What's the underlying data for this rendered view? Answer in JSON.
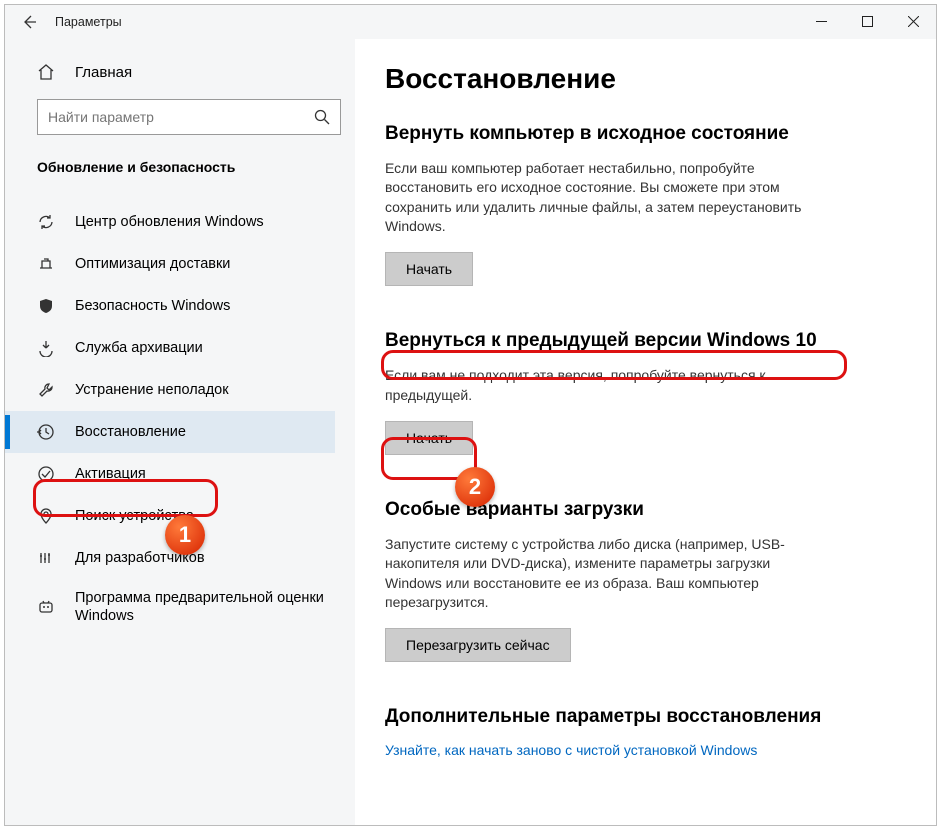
{
  "titlebar": {
    "title": "Параметры"
  },
  "sidebar": {
    "home": "Главная",
    "search_placeholder": "Найти параметр",
    "category": "Обновление и безопасность",
    "items": [
      {
        "label": "Центр обновления Windows"
      },
      {
        "label": "Оптимизация доставки"
      },
      {
        "label": "Безопасность Windows"
      },
      {
        "label": "Служба архивации"
      },
      {
        "label": "Устранение неполадок"
      },
      {
        "label": "Восстановление",
        "selected": true
      },
      {
        "label": "Активация"
      },
      {
        "label": "Поиск устройства"
      },
      {
        "label": "Для разработчиков"
      },
      {
        "label": "Программа предварительной оценки Windows"
      }
    ]
  },
  "main": {
    "title": "Восстановление",
    "reset": {
      "heading": "Вернуть компьютер в исходное состояние",
      "body": "Если ваш компьютер работает нестабильно, попробуйте восстановить его исходное состояние. Вы сможете при этом сохранить или удалить личные файлы, а затем переустановить Windows.",
      "button": "Начать"
    },
    "goback": {
      "heading": "Вернуться к предыдущей версии Windows 10",
      "body": "Если вам не подходит эта версия, попробуйте вернуться к предыдущей.",
      "button": "Начать"
    },
    "advanced": {
      "heading": "Особые варианты загрузки",
      "body": "Запустите систему с устройства либо диска (например, USB-накопителя или DVD-диска), измените параметры загрузки Windows или восстановите ее из образа. Ваш компьютер перезагрузится.",
      "button": "Перезагрузить сейчас"
    },
    "more_heading": "Дополнительные параметры восстановления",
    "more_link": "Узнайте, как начать заново с чистой установкой Windows"
  }
}
